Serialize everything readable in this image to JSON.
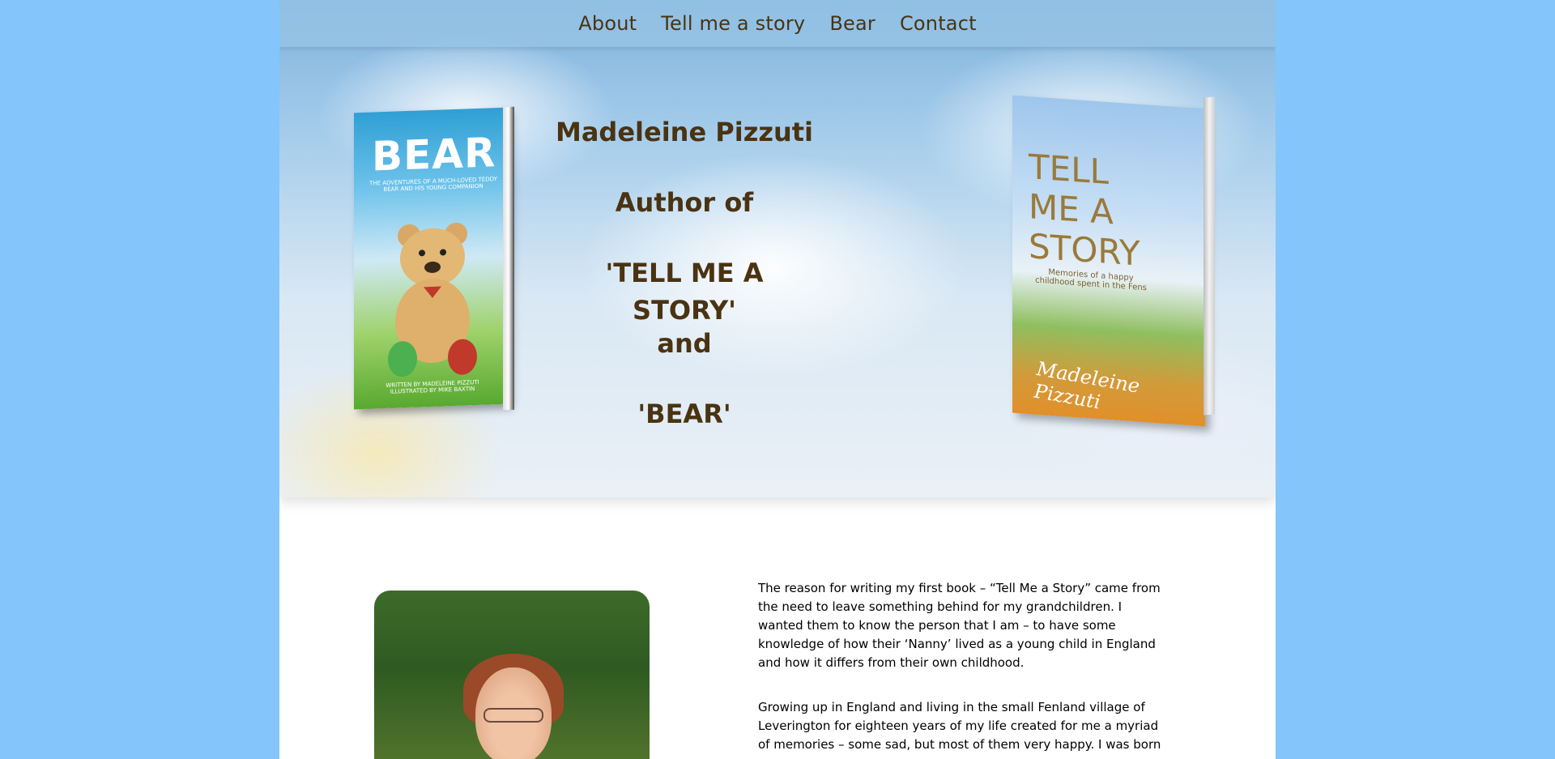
{
  "nav": {
    "items": [
      "About",
      "Tell me a story",
      "Bear",
      "Contact"
    ]
  },
  "hero": {
    "lines": [
      "Madeleine Pizzuti",
      "Author of",
      "'TELL ME A STORY'",
      "and",
      "'BEAR'"
    ]
  },
  "book_bear": {
    "title": "BEAR",
    "subtitle": "THE ADVENTURES OF A MUCH-LOVED TEDDY BEAR AND HIS YOUNG COMPANION",
    "credits": "WRITTEN BY MADELEINE PIZZUTI ILLUSTRATED BY MIKE BAXTIN"
  },
  "book_story": {
    "title": "TELL ME A STORY",
    "subtitle": "Memories of a happy childhood spent in the Fens",
    "author": "Madeleine Pizzuti"
  },
  "bio": {
    "paragraphs": [
      "The reason for writing my first book – “Tell Me a Story” came from the need to leave something behind for my grandchildren. I wanted them to know the person that I am – to have some knowledge of how their ‘Nanny’ lived as a young child in England and how it differs from their own childhood.",
      "Growing up in England and living in the small Fenland village of Leverington for eighteen years of my life created for me a myriad of memories – some sad, but most of them very happy. I was born"
    ]
  },
  "colors": {
    "background": "#84c5fb",
    "nav_text": "#4a3312",
    "hero_text": "#4a3312"
  }
}
